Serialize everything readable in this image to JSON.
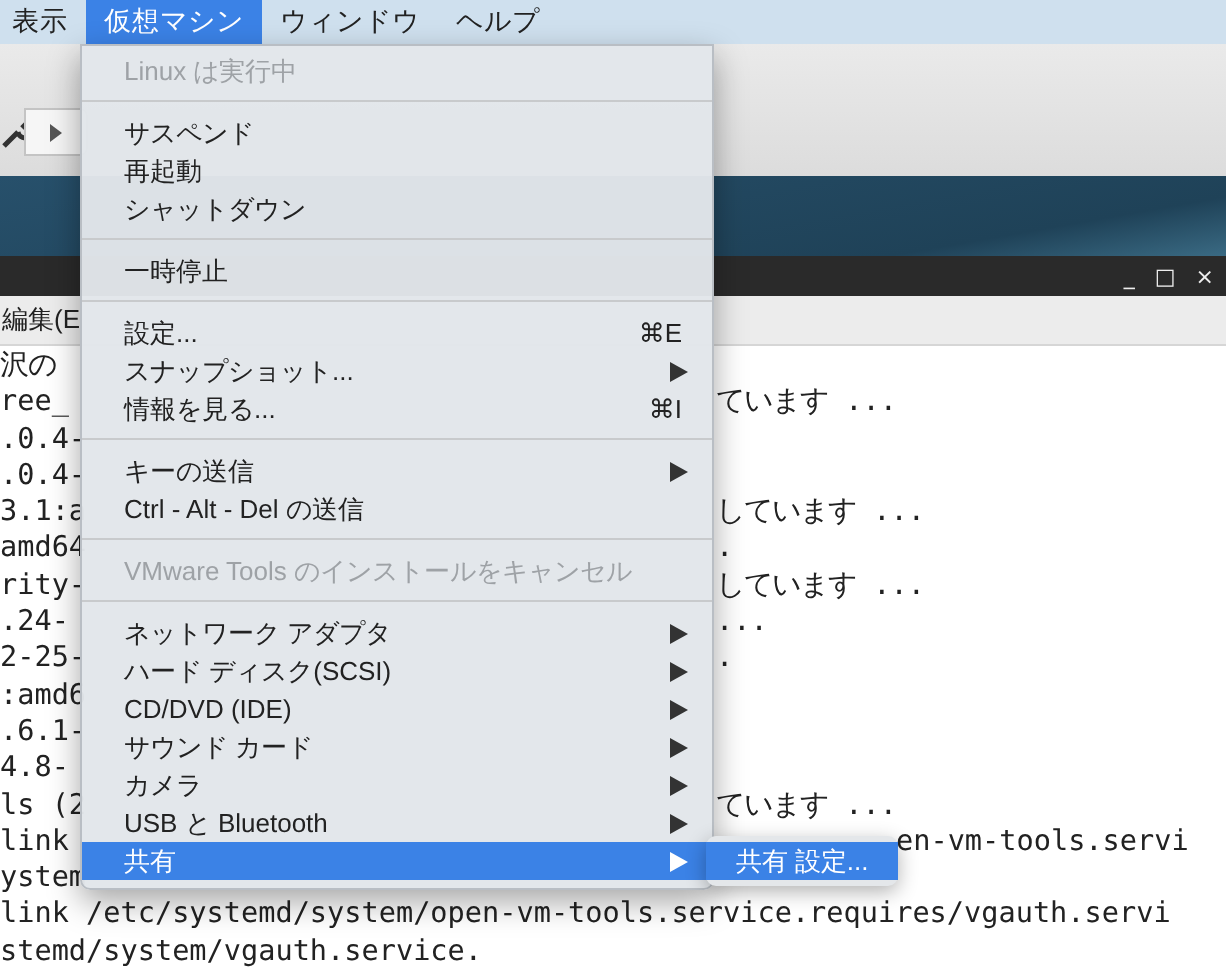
{
  "menubar": [
    {
      "label": "表示",
      "selected": false
    },
    {
      "label": "仮想マシン",
      "selected": true
    },
    {
      "label": "ウィンドウ",
      "selected": false
    },
    {
      "label": "ヘルプ",
      "selected": false
    }
  ],
  "window_controls": [
    "_",
    "□",
    "×"
  ],
  "terminal_menu": "編集(E",
  "terminal_lines": [
    {
      "kind": "split",
      "left": "沢の"
    },
    {
      "kind": "split",
      "left": "ree_",
      "right": "ています ..."
    },
    {
      "kind": "split",
      "left": ".0.4-"
    },
    {
      "kind": "split",
      "left": ".0.4-"
    },
    {
      "kind": "split",
      "left": "3.1:a",
      "right": "しています ..."
    },
    {
      "kind": "split",
      "left": "amd64",
      "right": "."
    },
    {
      "kind": "split",
      "left": "rity-",
      "right": "しています ..."
    },
    {
      "kind": "split",
      "left": ".24-",
      "right": "..."
    },
    {
      "kind": "split",
      "left": "2-25-",
      "right": "."
    },
    {
      "kind": "split",
      "left": ":amd6"
    },
    {
      "kind": "split",
      "left": ".6.1-"
    },
    {
      "kind": "split",
      "left": "4.8-"
    },
    {
      "kind": "split",
      "left": "ls (2",
      "right": "ています ..."
    },
    {
      "kind": "tail",
      "left": "link",
      "right": "en-vm-tools.servi"
    },
    {
      "kind": "split",
      "left": "ystem"
    },
    {
      "kind": "full",
      "left": "link /etc/systemd/system/open-vm-tools.service.requires/vgauth.servi"
    },
    {
      "kind": "full",
      "left": "stemd/system/vgauth.service."
    }
  ],
  "menu": [
    {
      "kind": "item",
      "label": "Linux は実行中",
      "disabled": true,
      "selected": false
    },
    {
      "kind": "separator"
    },
    {
      "kind": "item",
      "label": "サスペンド",
      "disabled": false,
      "selected": false
    },
    {
      "kind": "item",
      "label": "再起動",
      "disabled": false,
      "selected": false
    },
    {
      "kind": "item",
      "label": "シャットダウン",
      "disabled": false,
      "selected": false
    },
    {
      "kind": "separator"
    },
    {
      "kind": "item",
      "label": "一時停止",
      "disabled": false,
      "selected": false
    },
    {
      "kind": "separator"
    },
    {
      "kind": "item",
      "label": "設定...",
      "shortcut": "⌘E",
      "disabled": false,
      "selected": false
    },
    {
      "kind": "item",
      "label": "スナップショット...",
      "submenu": true,
      "disabled": false,
      "selected": false
    },
    {
      "kind": "item",
      "label": "情報を見る...",
      "shortcut": "⌘I",
      "disabled": false,
      "selected": false
    },
    {
      "kind": "separator"
    },
    {
      "kind": "item",
      "label": "キーの送信",
      "submenu": true,
      "disabled": false,
      "selected": false
    },
    {
      "kind": "item",
      "label": "Ctrl - Alt - Del の送信",
      "disabled": false,
      "selected": false
    },
    {
      "kind": "separator"
    },
    {
      "kind": "item",
      "label": "VMware Tools のインストールをキャンセル",
      "disabled": true,
      "selected": false
    },
    {
      "kind": "separator"
    },
    {
      "kind": "item",
      "label": "ネットワーク アダプタ",
      "submenu": true,
      "disabled": false,
      "selected": false
    },
    {
      "kind": "item",
      "label": "ハード ディスク(SCSI)",
      "submenu": true,
      "disabled": false,
      "selected": false
    },
    {
      "kind": "item",
      "label": "CD/DVD (IDE)",
      "submenu": true,
      "disabled": false,
      "selected": false
    },
    {
      "kind": "item",
      "label": "サウンド カード",
      "submenu": true,
      "disabled": false,
      "selected": false
    },
    {
      "kind": "item",
      "label": "カメラ",
      "submenu": true,
      "disabled": false,
      "selected": false
    },
    {
      "kind": "item",
      "label": "USB と Bluetooth",
      "submenu": true,
      "disabled": false,
      "selected": false
    },
    {
      "kind": "item",
      "label": "共有",
      "submenu": true,
      "disabled": false,
      "selected": true
    }
  ],
  "submenu": [
    {
      "label": "共有 設定...",
      "selected": true
    }
  ]
}
